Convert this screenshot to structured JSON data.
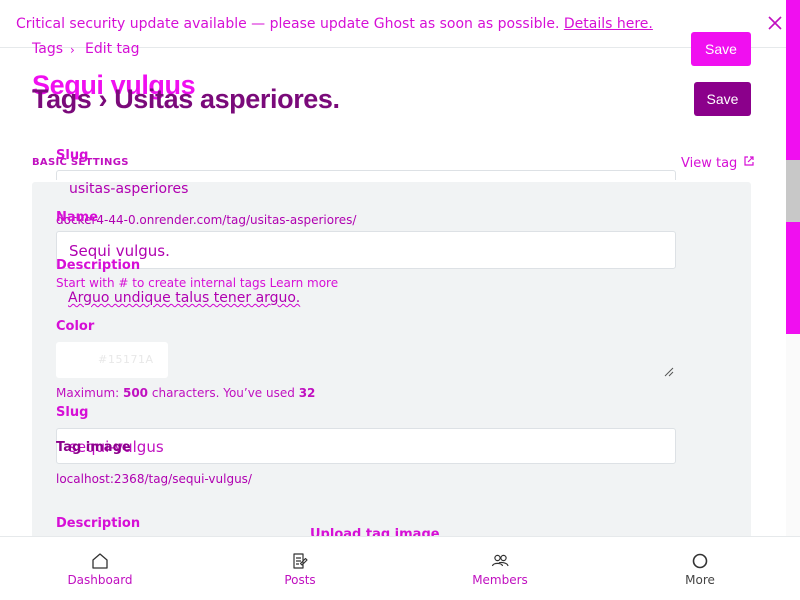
{
  "banner": {
    "message": "Critical security update available — please update Ghost as soon as possible.",
    "link_label": "Details here."
  },
  "breadcrumb": {
    "parent": "Tags",
    "separator": "›",
    "current": "Edit tag"
  },
  "header": {
    "title_tag": "Sequi vulgus",
    "title_main": "Tags › Usitas asperiores.",
    "save_label_1": "Save",
    "save_label_2": "Save"
  },
  "settings": {
    "section_label": "BASIC SETTINGS",
    "view_tag_label": "View tag",
    "slug_label_top": "Slug",
    "slug_value_top": "usitas-asperiores",
    "url_top": "docker4-44-0.onrender.com/tag/usitas-asperiores/",
    "name_label": "Name",
    "name_value": "Sequi vulgus.",
    "name_help": "Start with # to create internal tags",
    "learn_more": "Learn more",
    "description_label_top": "Description",
    "description_value": "Arguo undique talus tener arguo.",
    "color_label": "Color",
    "color_hex": "15171A",
    "char_count": {
      "prefix": "Maximum: ",
      "max": "500",
      "mid": " characters. You’ve used ",
      "used": "32"
    },
    "slug_label": "Slug",
    "slug_value": "sequi-vulgus",
    "tag_image_label": "Tag image",
    "url": "localhost:2368/tag/sequi-vulgus/",
    "description_label": "Description",
    "upload_label": "Upload tag image"
  },
  "nav": {
    "items": [
      {
        "label": "Dashboard",
        "icon": "home-icon"
      },
      {
        "label": "Posts",
        "icon": "posts-icon"
      },
      {
        "label": "Members",
        "icon": "members-icon"
      },
      {
        "label": "More",
        "icon": "more-icon"
      }
    ]
  },
  "colors": {
    "accent": "#f00ff0",
    "accent_dark": "#8b008b",
    "panel": "#f1f3f4"
  }
}
